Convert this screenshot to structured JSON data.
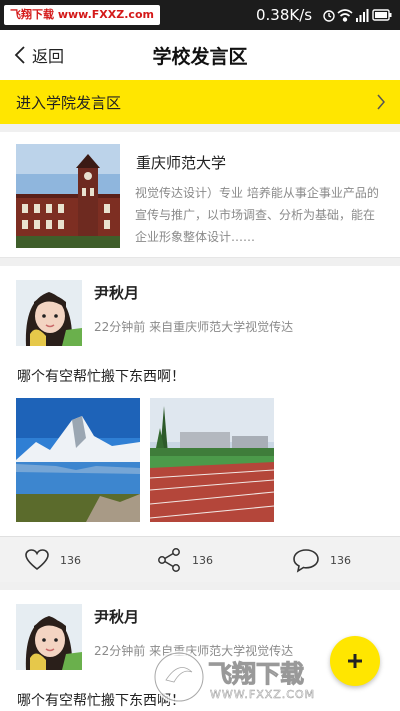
{
  "statusbar": {
    "watermark": "飞翔下载 www.FXXZ.com",
    "net_speed": "0.38K/s",
    "icons": [
      "alarm-icon",
      "wifi-icon",
      "signal-icon",
      "battery-icon"
    ]
  },
  "header": {
    "back_label": "返回",
    "title": "学校发言区"
  },
  "banner": {
    "label": "进入学院发言区"
  },
  "school": {
    "name": "重庆师范大学",
    "description": "视觉传达设计）专业 培养能从事企事业产品的宣传与推广，以市场调查、分析为基础，能在企业形象整体设计……"
  },
  "posts": [
    {
      "author": "尹秋月",
      "meta": "22分钟前  来自重庆师范大学视觉传达",
      "text": "哪个有空帮忙搬下东西啊！",
      "photos": [
        "mountain-lake-photo",
        "running-track-photo"
      ],
      "likes": "136",
      "shares": "136",
      "comments": "136"
    },
    {
      "author": "尹秋月",
      "meta": "22分钟前  来自重庆师范大学视觉传达",
      "text": "哪个有空帮忙搬下东西啊！"
    }
  ],
  "fab": {
    "icon": "plus-icon"
  },
  "watermark_bottom": {
    "name": "飞翔下载",
    "url": "WWW.FXXZ.COM"
  },
  "colors": {
    "accent": "#ffe600",
    "statusbar": "#1c1c1c",
    "muted_text": "#8a8a8a"
  }
}
